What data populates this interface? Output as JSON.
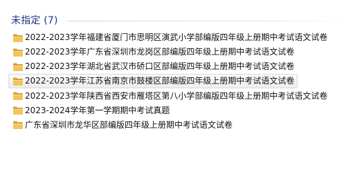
{
  "group": {
    "title": "未指定 (7)"
  },
  "items": [
    {
      "label": "2022-2023学年福建省厦门市思明区演武小学部编版四年级上册期中考试语文试卷",
      "icon": "folder-icon",
      "selected": false
    },
    {
      "label": "2022-2023学年广东省深圳市龙岗区部编版四年级上册期中考试语文试卷",
      "icon": "folder-icon",
      "selected": false
    },
    {
      "label": "2022-2023学年湖北省武汉市硚口区部编版四年级上册期中考试语文试卷",
      "icon": "folder-icon",
      "selected": false
    },
    {
      "label": "2022-2023学年江苏省南京市鼓楼区部编版四年级上册期中考试语文试卷",
      "icon": "folder-icon",
      "selected": true
    },
    {
      "label": "2022-2023学年陕西省西安市雁塔区第八小学部编版四年级上册期中考试语文试卷",
      "icon": "folder-icon",
      "selected": false
    },
    {
      "label": "2023-2024学年第一学期期中考试真题",
      "icon": "folder-icon",
      "selected": false
    },
    {
      "label": "广东省深圳市龙华区部编版四年级上册期中考试语文试卷",
      "icon": "folder-icon",
      "selected": false
    }
  ],
  "colors": {
    "group_title": "#1e3287",
    "folder_body": "#e8b84a",
    "folder_back": "#d9a23a",
    "selection_border": "#d9d9d9"
  }
}
